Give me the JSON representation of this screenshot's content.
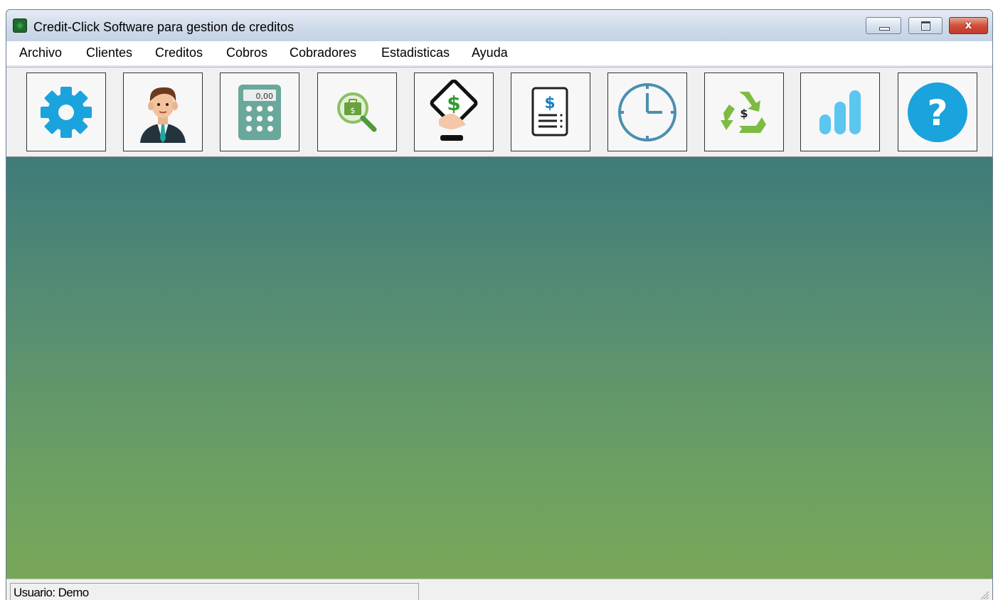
{
  "window": {
    "title": "Credit-Click Software para gestion de creditos",
    "close_label": "x"
  },
  "menu": {
    "items": [
      "Archivo",
      "Clientes",
      "Creditos",
      "Cobros",
      "Cobradores",
      "Estadisticas",
      "Ayuda"
    ]
  },
  "toolbar": {
    "buttons": [
      {
        "icon": "gear-icon"
      },
      {
        "icon": "client-avatar-icon"
      },
      {
        "icon": "calculator-icon",
        "display": "0,00"
      },
      {
        "icon": "money-search-icon",
        "symbol": "$"
      },
      {
        "icon": "payment-hand-icon",
        "symbol": "$"
      },
      {
        "icon": "invoice-icon",
        "symbol": "$"
      },
      {
        "icon": "clock-icon"
      },
      {
        "icon": "recycle-money-icon",
        "symbol": "$"
      },
      {
        "icon": "bar-stats-icon"
      },
      {
        "icon": "help-icon",
        "symbol": "?"
      }
    ]
  },
  "status": {
    "user_text": "Usuario: Demo"
  },
  "colors": {
    "workspace_top": "#3f7b7a",
    "workspace_bottom": "#79a758",
    "accent_blue": "#1aa3dc",
    "accent_green": "#7dbb42"
  }
}
